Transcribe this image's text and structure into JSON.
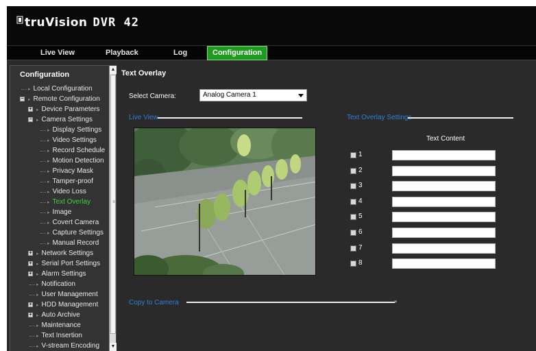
{
  "header": {
    "brand": "truVision",
    "model": "DVR 42"
  },
  "nav": {
    "tabs": [
      {
        "label": "Live View",
        "active": false
      },
      {
        "label": "Playback",
        "active": false
      },
      {
        "label": "Log",
        "active": false
      },
      {
        "label": "Configuration",
        "active": true
      }
    ]
  },
  "sidebar": {
    "title": "Configuration",
    "items": [
      {
        "label": "Local Configuration",
        "level": 0,
        "expander": null
      },
      {
        "label": "Remote Configuration",
        "level": 0,
        "expander": "minus"
      },
      {
        "label": "Device Parameters",
        "level": 1,
        "expander": "plus"
      },
      {
        "label": "Camera Settings",
        "level": 1,
        "expander": "minus"
      },
      {
        "label": "Display Settings",
        "level": 2,
        "expander": null
      },
      {
        "label": "Video Settings",
        "level": 2,
        "expander": null
      },
      {
        "label": "Record Schedule",
        "level": 2,
        "expander": null
      },
      {
        "label": "Motion Detection",
        "level": 2,
        "expander": null
      },
      {
        "label": "Privacy Mask",
        "level": 2,
        "expander": null
      },
      {
        "label": "Tamper-proof",
        "level": 2,
        "expander": null
      },
      {
        "label": "Video Loss",
        "level": 2,
        "expander": null
      },
      {
        "label": "Text Overlay",
        "level": 2,
        "expander": null,
        "active": true
      },
      {
        "label": "Image",
        "level": 2,
        "expander": null
      },
      {
        "label": "Covert Camera",
        "level": 2,
        "expander": null
      },
      {
        "label": "Capture Settings",
        "level": 2,
        "expander": null
      },
      {
        "label": "Manual Record",
        "level": 2,
        "expander": null
      },
      {
        "label": "Network Settings",
        "level": 1,
        "expander": "plus"
      },
      {
        "label": "Serial Port Settings",
        "level": 1,
        "expander": "plus"
      },
      {
        "label": "Alarm Settings",
        "level": 1,
        "expander": "plus"
      },
      {
        "label": "Notification",
        "level": 1,
        "expander": null
      },
      {
        "label": "User Management",
        "level": 1,
        "expander": null
      },
      {
        "label": "HDD Management",
        "level": 1,
        "expander": "plus"
      },
      {
        "label": "Auto Archive",
        "level": 1,
        "expander": "plus"
      },
      {
        "label": "Maintenance",
        "level": 1,
        "expander": null
      },
      {
        "label": "Text Insertion",
        "level": 1,
        "expander": null
      },
      {
        "label": "V-stream Encoding",
        "level": 1,
        "expander": null
      }
    ]
  },
  "main": {
    "title": "Text Overlay",
    "select_camera_label": "Select Camera:",
    "select_camera_value": "Analog Camera 1",
    "live_view_label": "Live View",
    "overlay_settings_label": "Text Overlay Settings",
    "text_content_header": "Text Content",
    "overlay_rows": [
      {
        "num": "1",
        "checked": false,
        "text": ""
      },
      {
        "num": "2",
        "checked": false,
        "text": ""
      },
      {
        "num": "3",
        "checked": false,
        "text": ""
      },
      {
        "num": "4",
        "checked": false,
        "text": ""
      },
      {
        "num": "5",
        "checked": false,
        "text": ""
      },
      {
        "num": "6",
        "checked": false,
        "text": ""
      },
      {
        "num": "7",
        "checked": false,
        "text": ""
      },
      {
        "num": "8",
        "checked": false,
        "text": ""
      }
    ],
    "copy_to_camera_label": "Copy to Camera",
    "copy_expand_glyph": "»"
  },
  "colors": {
    "accent_green": "#1e9a1e",
    "section_blue": "#2f7fd6",
    "active_item": "#3fd23f"
  }
}
